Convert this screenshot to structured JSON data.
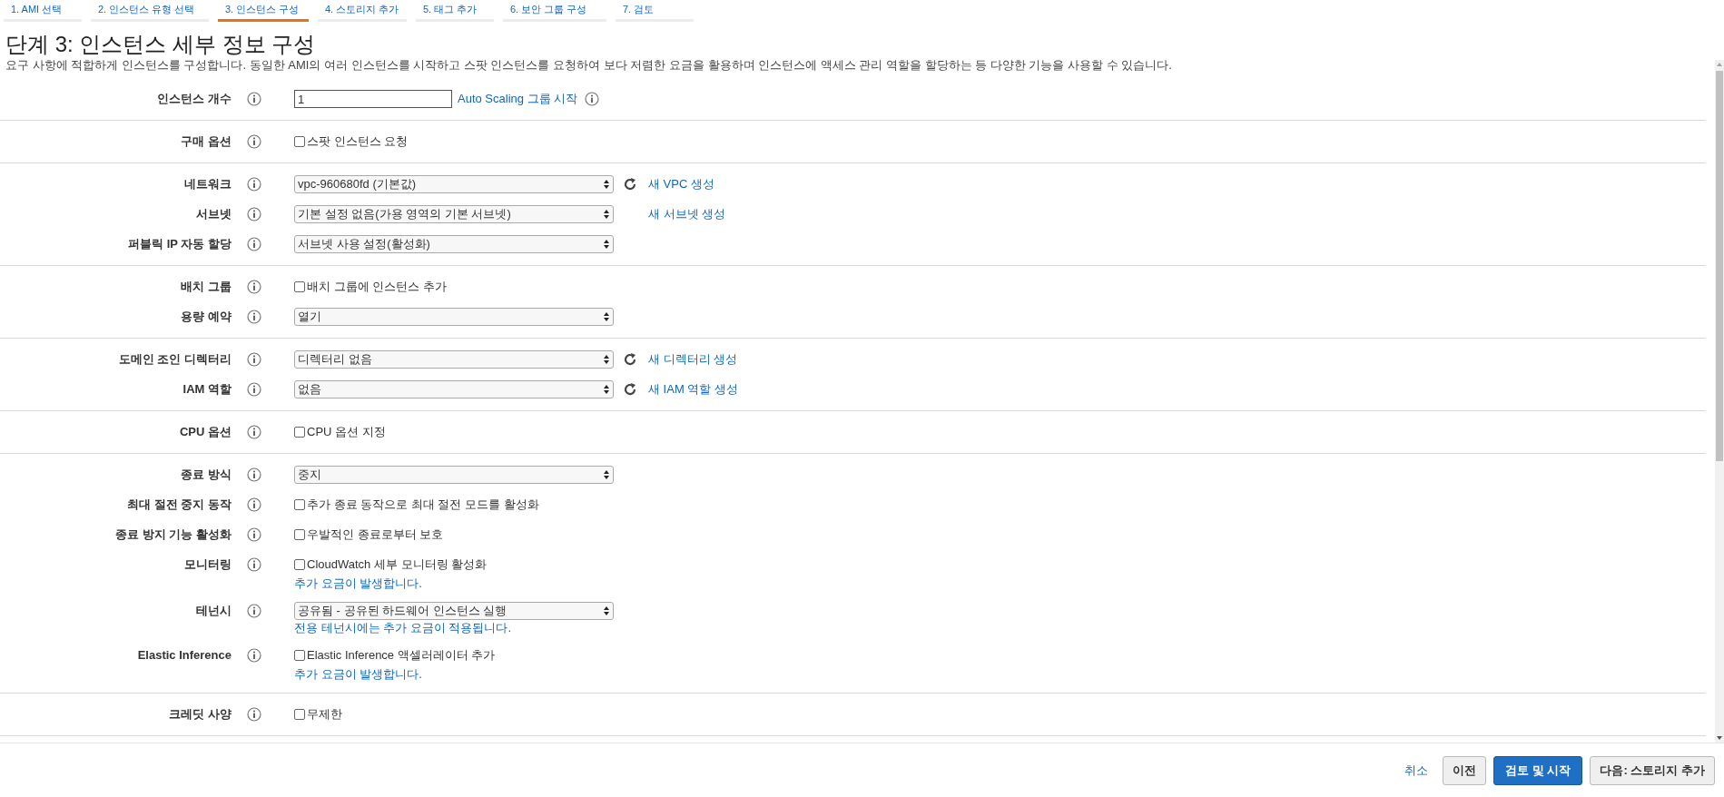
{
  "tabs": [
    {
      "label": "1. AMI 선택",
      "selected": false
    },
    {
      "label": "2. 인스턴스 유형 선택",
      "selected": false
    },
    {
      "label": "3. 인스턴스 구성",
      "selected": true
    },
    {
      "label": "4. 스토리지 추가",
      "selected": false
    },
    {
      "label": "5. 태그 추가",
      "selected": false
    },
    {
      "label": "6. 보안 그룹 구성",
      "selected": false
    },
    {
      "label": "7. 검토",
      "selected": false
    }
  ],
  "title": "단계 3: 인스턴스 세부 정보 구성",
  "description": "요구 사항에 적합하게 인스턴스를 구성합니다. 동일한 AMI의 여러 인스턴스를 시작하고 스팟 인스턴스를 요청하여 보다 저렴한 요금을 활용하며 인스턴스에 액세스 관리 역할을 할당하는 등 다양한 기능을 사용할 수 있습니다.",
  "sections": [
    {
      "rows": [
        {
          "label": "인스턴스 개수",
          "control": {
            "kind": "text-input",
            "value": "1"
          },
          "refresh": false,
          "link": {
            "text": "Auto Scaling 그룹 시작",
            "info": true
          }
        }
      ]
    },
    {
      "rows": [
        {
          "label": "구매 옵션",
          "control": {
            "kind": "checkbox",
            "label": "스팟 인스턴스 요청",
            "checked": false
          },
          "refresh": false
        }
      ]
    },
    {
      "rows": [
        {
          "label": "네트워크",
          "control": {
            "kind": "select",
            "value": "vpc-960680fd (기본값)"
          },
          "refresh": true,
          "link": {
            "text": "새 VPC 생성",
            "info": false
          }
        },
        {
          "label": "서브넷",
          "control": {
            "kind": "select",
            "value": "기본 설정 없음(가용 영역의 기본 서브넷)"
          },
          "refresh": false,
          "link": {
            "text": "새 서브넷 생성",
            "info": false
          }
        },
        {
          "label": "퍼블릭 IP 자동 할당",
          "control": {
            "kind": "select",
            "value": "서브넷 사용 설정(활성화)"
          },
          "refresh": false
        }
      ]
    },
    {
      "rows": [
        {
          "label": "배치 그룹",
          "control": {
            "kind": "checkbox",
            "label": "배치 그룹에 인스턴스 추가",
            "checked": false
          },
          "refresh": false
        },
        {
          "label": "용량 예약",
          "control": {
            "kind": "select",
            "value": "열기"
          },
          "refresh": false
        }
      ]
    },
    {
      "rows": [
        {
          "label": "도메인 조인 디렉터리",
          "control": {
            "kind": "select",
            "value": "디렉터리 없음"
          },
          "refresh": true,
          "link": {
            "text": "새 디렉터리 생성",
            "info": false
          }
        },
        {
          "label": "IAM 역할",
          "control": {
            "kind": "select",
            "value": "없음"
          },
          "refresh": true,
          "link": {
            "text": "새 IAM 역할 생성",
            "info": false
          }
        }
      ]
    },
    {
      "rows": [
        {
          "label": "CPU 옵션",
          "control": {
            "kind": "checkbox",
            "label": "CPU 옵션 지정",
            "checked": false
          },
          "refresh": false
        }
      ]
    },
    {
      "rows": [
        {
          "label": "종료 방식",
          "control": {
            "kind": "select",
            "value": "중지"
          },
          "refresh": false
        },
        {
          "label": "최대 절전 중지 동작",
          "control": {
            "kind": "checkbox",
            "label": "추가 종료 동작으로 최대 절전 모드를 활성화",
            "checked": false
          },
          "refresh": false
        },
        {
          "label": "종료 방지 기능 활성화",
          "control": {
            "kind": "checkbox",
            "label": "우발적인 종료로부터 보호",
            "checked": false
          },
          "refresh": false
        },
        {
          "label": "모니터링",
          "control": {
            "kind": "checkbox",
            "label": "CloudWatch 세부 모니터링 활성화",
            "checked": false
          },
          "refresh": false,
          "note": "추가 요금이 발생합니다."
        },
        {
          "label": "테넌시",
          "control": {
            "kind": "select",
            "value": "공유됨 - 공유된 하드웨어 인스턴스 실행"
          },
          "refresh": false,
          "note": "전용 테넌시에는 추가 요금이 적용됩니다."
        },
        {
          "label": "Elastic Inference",
          "control": {
            "kind": "checkbox",
            "label": "Elastic Inference 액셀러레이터 추가",
            "checked": false
          },
          "refresh": false,
          "note": "추가 요금이 발생합니다."
        }
      ]
    },
    {
      "rows": [
        {
          "label": "크레딧 사양",
          "control": {
            "kind": "checkbox",
            "label": "무제한",
            "checked": false
          },
          "refresh": false
        }
      ]
    }
  ],
  "footer": [
    {
      "kind": "link",
      "label": "취소"
    },
    {
      "kind": "default",
      "label": "이전"
    },
    {
      "kind": "primary",
      "label": "검토 및 시작"
    },
    {
      "kind": "default",
      "label": "다음: 스토리지 추가"
    }
  ]
}
